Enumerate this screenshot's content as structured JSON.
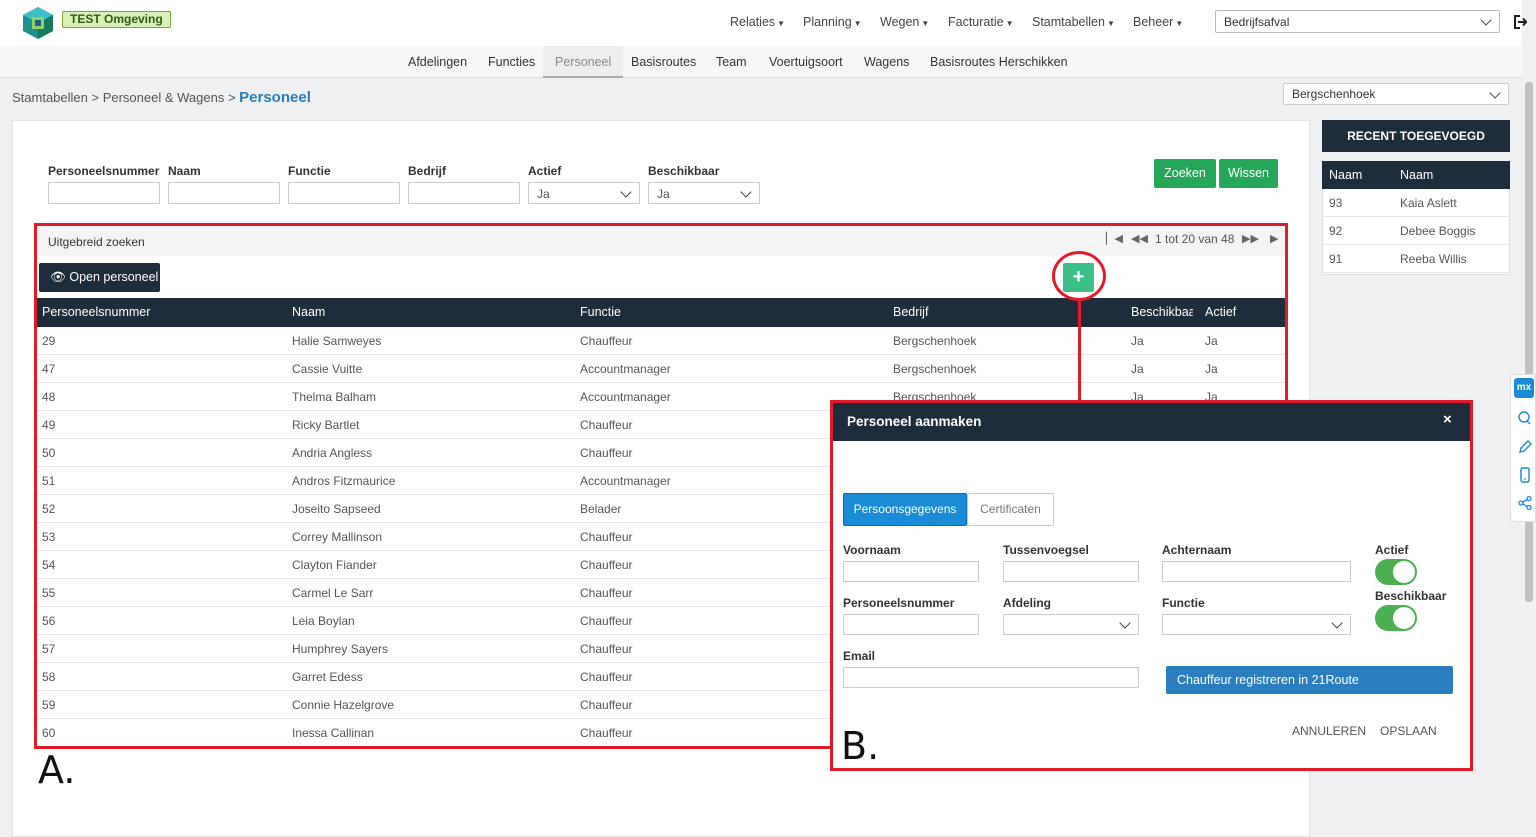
{
  "header": {
    "env_badge": "TEST Omgeving",
    "menu": [
      "Relaties",
      "Planning",
      "Wegen",
      "Facturatie",
      "Stamtabellen",
      "Beheer"
    ],
    "company_select": "Bedrijfsafval"
  },
  "subnav": {
    "tabs": [
      "Afdelingen",
      "Functies",
      "Personeel",
      "Basisroutes",
      "Team",
      "Voertuigsoort",
      "Wagens",
      "Basisroutes Herschikken"
    ],
    "active": "Personeel"
  },
  "breadcrumb": {
    "path": "Stamtabellen > Personeel & Wagens > ",
    "current": "Personeel"
  },
  "location_select": "Bergschenhoek",
  "search": {
    "labels": [
      "Personeelsnummer",
      "Naam",
      "Functie",
      "Bedrijf",
      "Actief",
      "Beschikbaar"
    ],
    "actief_value": "Ja",
    "beschikbaar_value": "Ja",
    "search_button": "Zoeken",
    "clear_button": "Wissen"
  },
  "advanced": {
    "label": "Uitgebreid zoeken",
    "pager_text": "1 tot 20 van 48"
  },
  "open_button": "Open personeel",
  "add_button": "+",
  "table": {
    "headers": [
      "Personeelsnummer",
      "Naam",
      "Functie",
      "Bedrijf",
      "Beschikbaar",
      "Actief"
    ],
    "rows": [
      [
        "29",
        "Halie Samweyes",
        "Chauffeur",
        "Bergschenhoek",
        "Ja",
        "Ja"
      ],
      [
        "47",
        "Cassie Vuitte",
        "Accountmanager",
        "Bergschenhoek",
        "Ja",
        "Ja"
      ],
      [
        "48",
        "Thelma Balham",
        "Accountmanager",
        "Bergschenhoek",
        "Ja",
        "Ja"
      ],
      [
        "49",
        "Ricky Bartlet",
        "Chauffeur",
        "",
        "",
        ""
      ],
      [
        "50",
        "Andria Angless",
        "Chauffeur",
        "",
        "",
        ""
      ],
      [
        "51",
        "Andros Fitzmaurice",
        "Accountmanager",
        "",
        "",
        ""
      ],
      [
        "52",
        "Joseito Sapseed",
        "Belader",
        "",
        "",
        ""
      ],
      [
        "53",
        "Correy Mallinson",
        "Chauffeur",
        "",
        "",
        ""
      ],
      [
        "54",
        "Clayton Fiander",
        "Chauffeur",
        "",
        "",
        ""
      ],
      [
        "55",
        "Carmel Le Sarr",
        "Chauffeur",
        "",
        "",
        ""
      ],
      [
        "56",
        "Leia Boylan",
        "Chauffeur",
        "",
        "",
        ""
      ],
      [
        "57",
        "Humphrey Sayers",
        "Chauffeur",
        "",
        "",
        ""
      ],
      [
        "58",
        "Garret Edess",
        "Chauffeur",
        "",
        "",
        ""
      ],
      [
        "59",
        "Connie Hazelgrove",
        "Chauffeur",
        "",
        "",
        ""
      ],
      [
        "60",
        "Inessa Callinan",
        "Chauffeur",
        "",
        "",
        ""
      ]
    ]
  },
  "recent": {
    "title": "RECENT TOEGEVOEGD",
    "headers": [
      "Naam",
      "Naam"
    ],
    "rows": [
      [
        "93",
        "Kaia Aslett"
      ],
      [
        "92",
        "Debee Boggis"
      ],
      [
        "91",
        "Reeba Willis"
      ]
    ]
  },
  "side_tools": {
    "badge": "mx",
    "icons": [
      "chat-icon",
      "pencil-icon",
      "mobile-icon",
      "share-icon"
    ]
  },
  "annotations": {
    "label_a": "A.",
    "label_b": "B."
  },
  "modal": {
    "title": "Personeel aanmaken",
    "close": "×",
    "tab_active": "Persoonsgegevens",
    "tab_other": "Certificaten",
    "labels": {
      "voornaam": "Voornaam",
      "tussenvoegsel": "Tussenvoegsel",
      "achternaam": "Achternaam",
      "actief": "Actief",
      "personeelsnummer": "Personeelsnummer",
      "afdeling": "Afdeling",
      "functie": "Functie",
      "beschikbaar": "Beschikbaar",
      "email": "Email"
    },
    "actief_on": true,
    "beschikbaar_on": true,
    "register_button": "Chauffeur registreren in 21Route",
    "cancel_button": "ANNULEREN",
    "save_button": "OPSLAAN"
  },
  "colors": {
    "navy": "#1e2d3b",
    "green": "#25a75a",
    "blue": "#1a8bd6",
    "annotation_red": "#e21b2a"
  }
}
